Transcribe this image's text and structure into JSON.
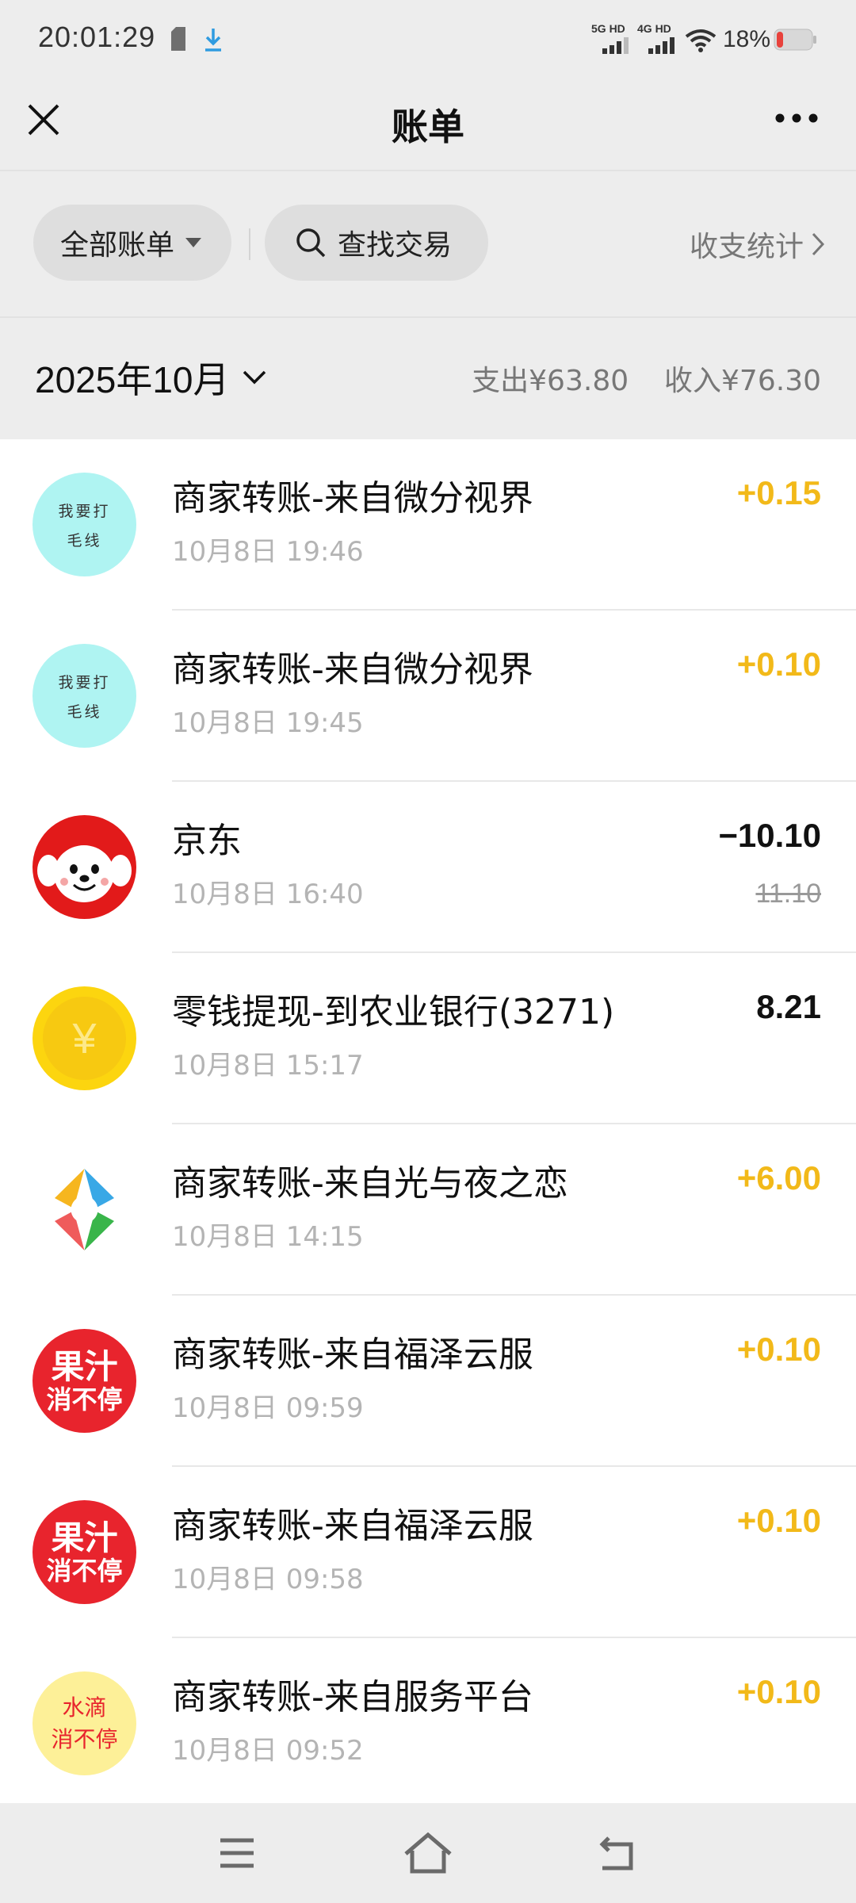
{
  "status_bar": {
    "time": "20:01:29",
    "network_1": "5G HD",
    "network_2": "4G HD",
    "battery": "18%"
  },
  "nav": {
    "title": "账单"
  },
  "filters": {
    "all_bills": "全部账单",
    "search": "查找交易",
    "stats": "收支统计"
  },
  "month": {
    "label": "2025年10月",
    "expense": "支出¥63.80",
    "income": "收入¥76.30"
  },
  "transactions": [
    {
      "avatar": "yarn",
      "avatar_text": [
        "我要打",
        "毛线"
      ],
      "title": "商家转账-来自微分视界",
      "time": "10月8日 19:46",
      "amount": "+0.15",
      "type": "income"
    },
    {
      "avatar": "yarn",
      "avatar_text": [
        "我要打",
        "毛线"
      ],
      "title": "商家转账-来自微分视界",
      "time": "10月8日 19:45",
      "amount": "+0.10",
      "type": "income"
    },
    {
      "avatar": "jd",
      "title": "京东",
      "time": "10月8日 16:40",
      "amount": "−10.10",
      "original": "11.10",
      "type": "expense"
    },
    {
      "avatar": "coin",
      "avatar_text": [
        "¥"
      ],
      "title": "零钱提现-到农业银行(3271)",
      "time": "10月8日 15:17",
      "amount": "8.21",
      "type": "neutral"
    },
    {
      "avatar": "pinwheel",
      "title": "商家转账-来自光与夜之恋",
      "time": "10月8日 14:15",
      "amount": "+6.00",
      "type": "income"
    },
    {
      "avatar": "juice",
      "avatar_text": [
        "果汁",
        "消不停"
      ],
      "title": "商家转账-来自福泽云服",
      "time": "10月8日 09:59",
      "amount": "+0.10",
      "type": "income"
    },
    {
      "avatar": "juice",
      "avatar_text": [
        "果汁",
        "消不停"
      ],
      "title": "商家转账-来自福泽云服",
      "time": "10月8日 09:58",
      "amount": "+0.10",
      "type": "income"
    },
    {
      "avatar": "water",
      "avatar_text": [
        "水滴",
        "消不停"
      ],
      "title": "商家转账-来自服务平台",
      "time": "10月8日 09:52",
      "amount": "+0.10",
      "type": "income"
    }
  ],
  "colors": {
    "income": "#f2b919",
    "background": "#ededed",
    "list_background": "#ffffff"
  }
}
